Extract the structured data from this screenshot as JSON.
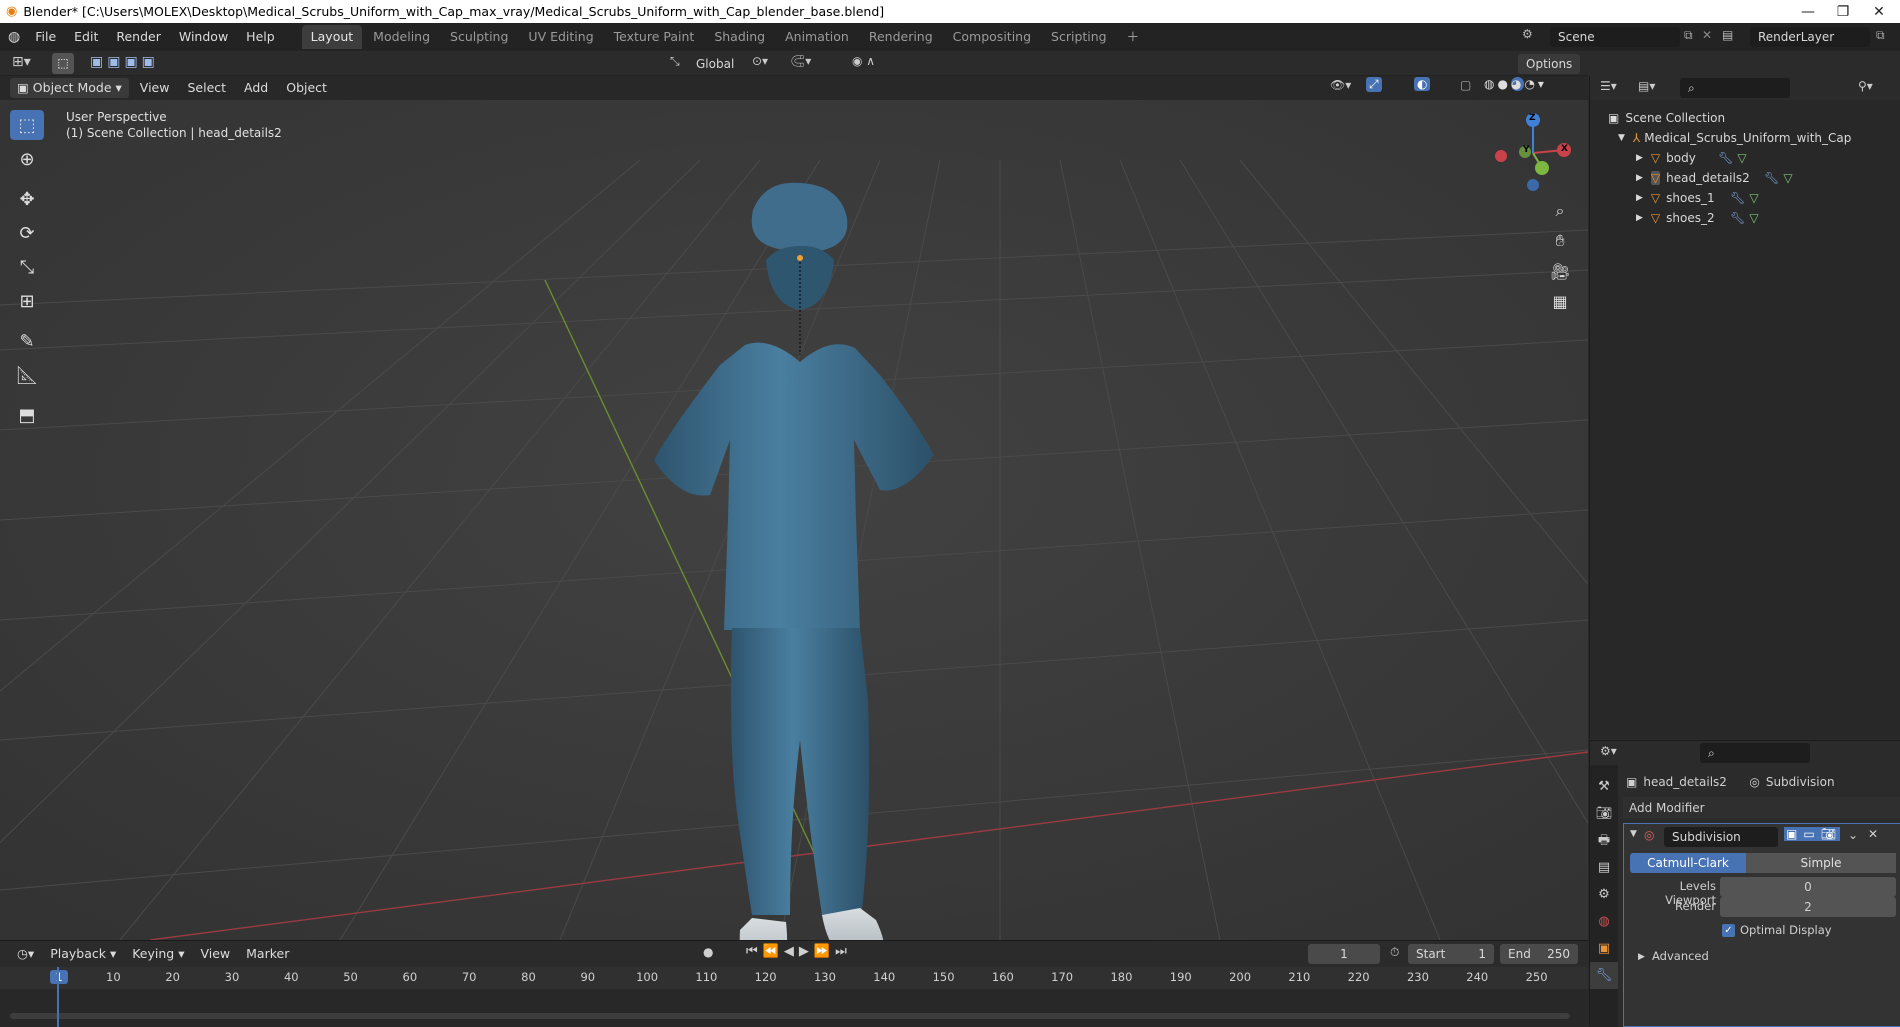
{
  "title": "Blender* [C:\\Users\\MOLEX\\Desktop\\Medical_Scrubs_Uniform_with_Cap_max_vray/Medical_Scrubs_Uniform_with_Cap_blender_base.blend]",
  "menu": [
    "File",
    "Edit",
    "Render",
    "Window",
    "Help"
  ],
  "workspaces": [
    "Layout",
    "Modeling",
    "Sculpting",
    "UV Editing",
    "Texture Paint",
    "Shading",
    "Animation",
    "Rendering",
    "Compositing",
    "Scripting"
  ],
  "active_workspace": "Layout",
  "scene": "Scene",
  "render_layer": "RenderLayer",
  "toolbar": {
    "transform": "Global",
    "options": "Options"
  },
  "viewport_header": {
    "mode": "Object Mode",
    "view": "View",
    "select": "Select",
    "add": "Add",
    "object": "Object"
  },
  "viewport_info": {
    "line1": "User Perspective",
    "line2": "(1) Scene Collection | head_details2"
  },
  "gizmo": {
    "x": "X",
    "y": "Y",
    "z": "Z"
  },
  "outliner": {
    "root": "Scene Collection",
    "collection": "Medical_Scrubs_Uniform_with_Cap",
    "items": [
      "body",
      "head_details2",
      "shoes_1",
      "shoes_2"
    ]
  },
  "properties": {
    "object": "head_details2",
    "modifier_tab": "Subdivision",
    "add_modifier": "Add Modifier",
    "modifier_name": "Subdivision",
    "catmull": "Catmull-Clark",
    "simple": "Simple",
    "levels_label": "Levels Viewport",
    "levels_value": "0",
    "render_label": "Render",
    "render_value": "2",
    "optimal": "Optimal Display",
    "advanced": "Advanced"
  },
  "timeline": {
    "playback": "Playback",
    "keying": "Keying",
    "view": "View",
    "marker": "Marker",
    "current_frame": "1",
    "start_label": "Start",
    "start": "1",
    "end_label": "End",
    "end": "250",
    "ticks": [
      "1",
      "10",
      "20",
      "30",
      "40",
      "50",
      "60",
      "70",
      "80",
      "90",
      "100",
      "110",
      "120",
      "130",
      "140",
      "150",
      "160",
      "170",
      "180",
      "190",
      "200",
      "210",
      "220",
      "230",
      "240",
      "250"
    ]
  },
  "colors": {
    "accent": "#4772b3",
    "x_axis": "#c9424a",
    "y_axis": "#7db742",
    "z_axis": "#3f80d8",
    "scrubs": "#3d6a87"
  }
}
